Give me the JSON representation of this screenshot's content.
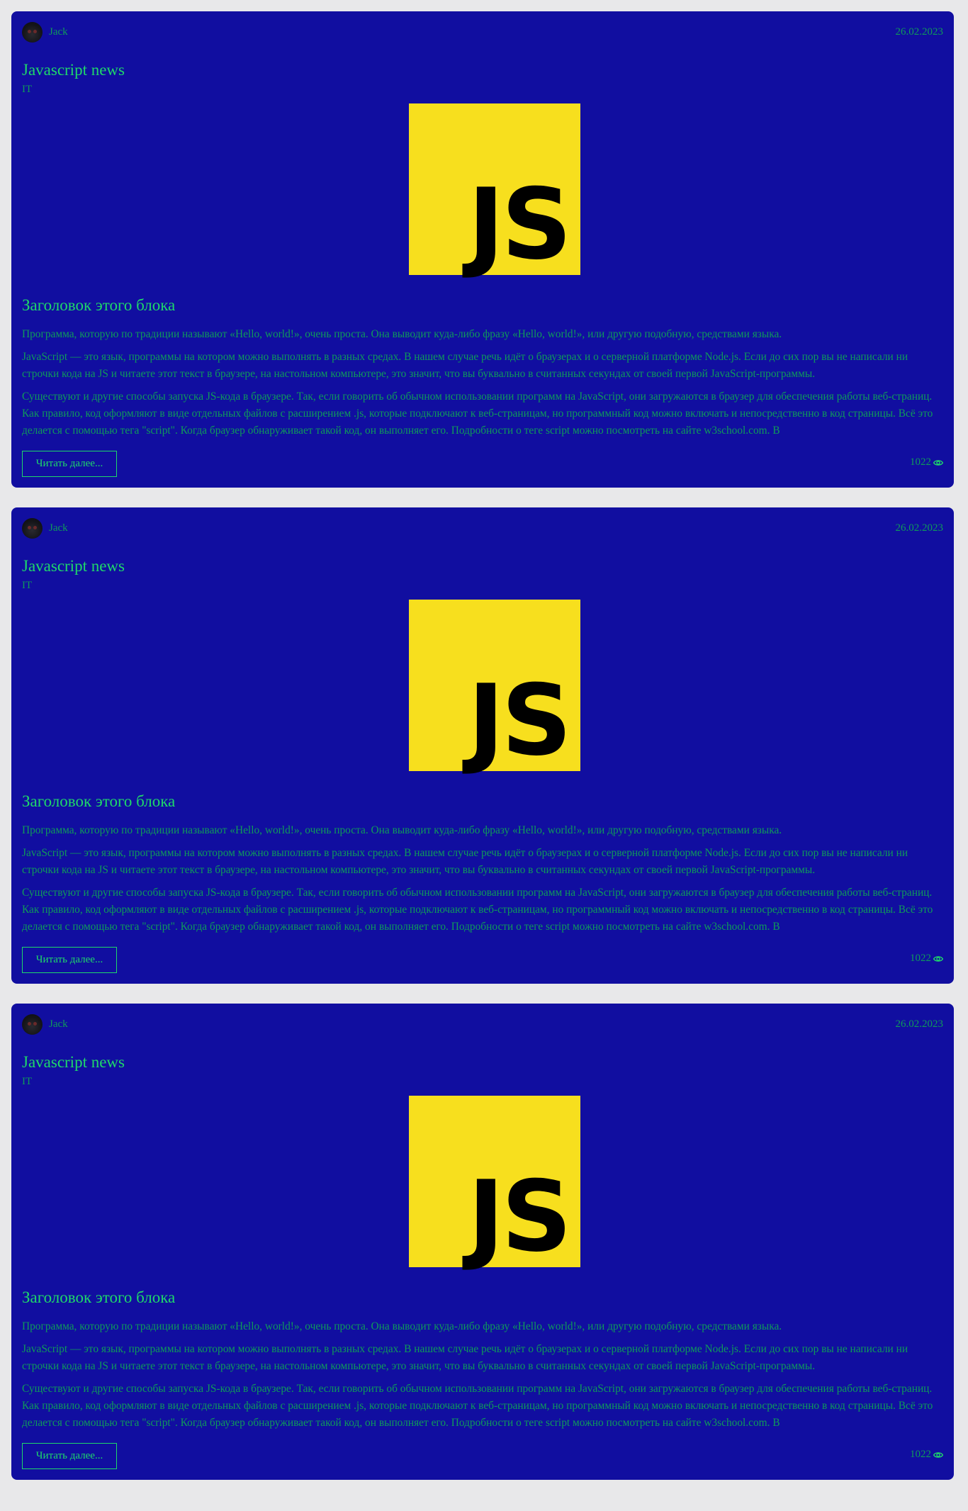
{
  "posts": [
    {
      "author": "Jack",
      "date": "26.02.2023",
      "title": "Javascript news",
      "category": "IT",
      "image_text": "JS",
      "subtitle": "Заголовок этого блока",
      "paragraphs": [
        "Программа, которую по традиции называют «Hello, world!», очень проста. Она выводит куда-либо фразу «Hello, world!», или другую подобную, средствами языка.",
        "JavaScript — это язык, программы на котором можно выполнять в разных средах. В нашем случае речь идёт о браузерах и о серверной платформе Node.js. Если до сих пор вы не написали ни строчки кода на JS и читаете этот текст в браузере, на настольном компьютере, это значит, что вы буквально в считанных секундах от своей первой JavaScript-программы.",
        "Существуют и другие способы запуска JS-кода в браузере. Так, если говорить об обычном использовании программ на JavaScript, они загружаются в браузер для обеспечения работы веб-страниц. Как правило, код оформляют в виде отдельных файлов с расширением .js, которые подключают к веб-страницам, но программный код можно включать и непосредственно в код страницы. Всё это делается с помощью тега \"script\". Когда браузер обнаруживает такой код, он выполняет его. Подробности о теге script можно посмотреть на сайте w3school.com. В"
      ],
      "read_more": "Читать далее...",
      "views": "1022"
    },
    {
      "author": "Jack",
      "date": "26.02.2023",
      "title": "Javascript news",
      "category": "IT",
      "image_text": "JS",
      "subtitle": "Заголовок этого блока",
      "paragraphs": [
        "Программа, которую по традиции называют «Hello, world!», очень проста. Она выводит куда-либо фразу «Hello, world!», или другую подобную, средствами языка.",
        "JavaScript — это язык, программы на котором можно выполнять в разных средах. В нашем случае речь идёт о браузерах и о серверной платформе Node.js. Если до сих пор вы не написали ни строчки кода на JS и читаете этот текст в браузере, на настольном компьютере, это значит, что вы буквально в считанных секундах от своей первой JavaScript-программы.",
        "Существуют и другие способы запуска JS-кода в браузере. Так, если говорить об обычном использовании программ на JavaScript, они загружаются в браузер для обеспечения работы веб-страниц. Как правило, код оформляют в виде отдельных файлов с расширением .js, которые подключают к веб-страницам, но программный код можно включать и непосредственно в код страницы. Всё это делается с помощью тега \"script\". Когда браузер обнаруживает такой код, он выполняет его. Подробности о теге script можно посмотреть на сайте w3school.com. В"
      ],
      "read_more": "Читать далее...",
      "views": "1022"
    },
    {
      "author": "Jack",
      "date": "26.02.2023",
      "title": "Javascript news",
      "category": "IT",
      "image_text": "JS",
      "subtitle": "Заголовок этого блока",
      "paragraphs": [
        "Программа, которую по традиции называют «Hello, world!», очень проста. Она выводит куда-либо фразу «Hello, world!», или другую подобную, средствами языка.",
        "JavaScript — это язык, программы на котором можно выполнять в разных средах. В нашем случае речь идёт о браузерах и о серверной платформе Node.js. Если до сих пор вы не написали ни строчки кода на JS и читаете этот текст в браузере, на настольном компьютере, это значит, что вы буквально в считанных секундах от своей первой JavaScript-программы.",
        "Существуют и другие способы запуска JS-кода в браузере. Так, если говорить об обычном использовании программ на JavaScript, они загружаются в браузер для обеспечения работы веб-страниц. Как правило, код оформляют в виде отдельных файлов с расширением .js, которые подключают к веб-страницам, но программный код можно включать и непосредственно в код страницы. Всё это делается с помощью тега \"script\". Когда браузер обнаруживает такой код, он выполняет его. Подробности о теге script можно посмотреть на сайте w3school.com. В"
      ],
      "read_more": "Читать далее...",
      "views": "1022"
    }
  ],
  "icons": {
    "avatar": "cat-avatar",
    "views": "eye-icon"
  },
  "colors": {
    "card_bg": "#110ea0",
    "accent_green": "#1ed86a",
    "muted_green": "#0f9a5a",
    "js_yellow": "#f7df1e",
    "page_bg": "#e8e8ea"
  }
}
